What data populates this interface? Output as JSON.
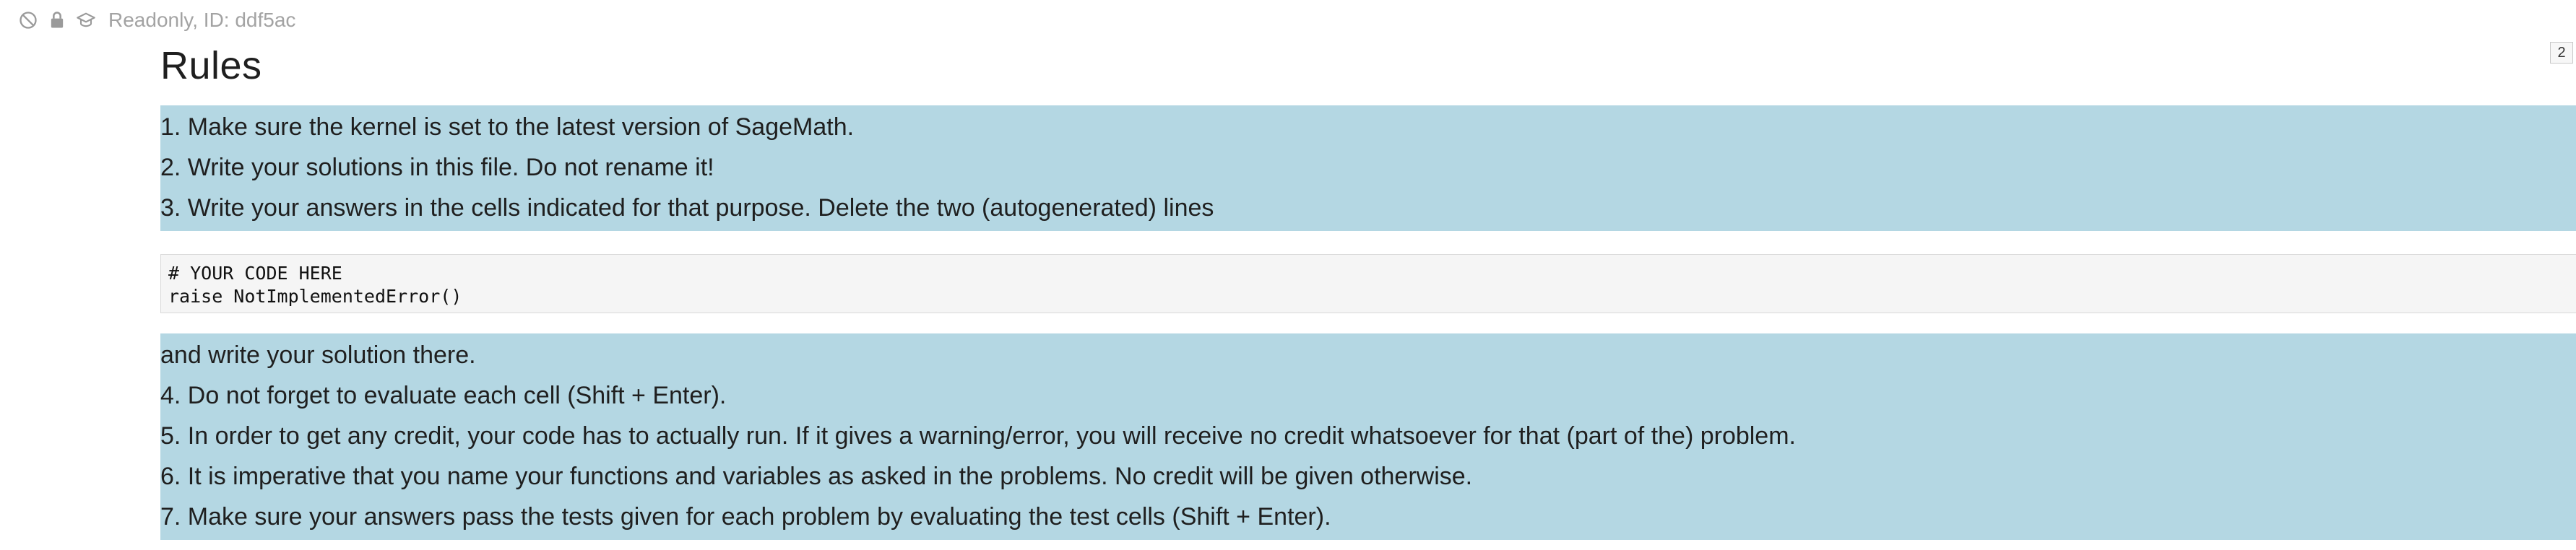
{
  "status": {
    "text": "Readonly, ID: ddf5ac",
    "icons": [
      "no-entry-icon",
      "lock-icon",
      "graduation-cap-icon"
    ]
  },
  "cell_counter": "2",
  "heading": "Rules",
  "block_a": [
    "1. Make sure the kernel is set to the latest version of SageMath.",
    "2. Write your solutions in this file. Do not rename it!",
    "3. Write your answers in the cells indicated for that purpose. Delete the two (autogenerated) lines"
  ],
  "code": [
    "# YOUR CODE HERE",
    "raise NotImplementedError()"
  ],
  "block_b": [
    "and write your solution there.",
    "4. Do not forget to evaluate each cell (Shift + Enter).",
    "5. In order to get any credit, your code has to actually run. If it gives a warning/error, you will receive no credit whatsoever for that (part of the) problem.",
    "6. It is imperative that you name your functions and variables as asked in the problems. No credit will be given otherwise.",
    "7. Make sure your answers pass the tests given for each problem by evaluating the test cells (Shift + Enter)."
  ],
  "colors": {
    "highlight": "#b4d7e3",
    "code_bg": "#f5f5f5",
    "status_text": "#a3a3a3"
  }
}
